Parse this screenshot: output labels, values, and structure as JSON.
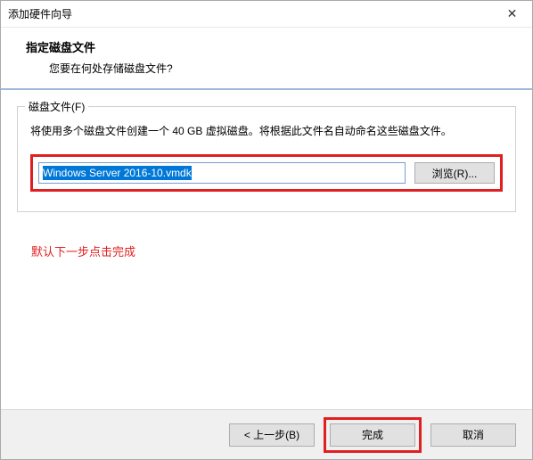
{
  "window": {
    "title": "添加硬件向导",
    "close_symbol": "✕"
  },
  "header": {
    "title": "指定磁盘文件",
    "subtitle": "您要在何处存储磁盘文件?"
  },
  "group": {
    "legend": "磁盘文件(F)",
    "description": "将使用多个磁盘文件创建一个 40 GB 虚拟磁盘。将根据此文件名自动命名这些磁盘文件。",
    "file_value": "Windows Server 2016-10.vmdk",
    "browse_label": "浏览(R)..."
  },
  "hint": "默认下一步点击完成",
  "footer": {
    "back_label": "< 上一步(B)",
    "finish_label": "完成",
    "cancel_label": "取消"
  },
  "colors": {
    "highlight": "#e02020",
    "selection_bg": "#0078d7"
  }
}
